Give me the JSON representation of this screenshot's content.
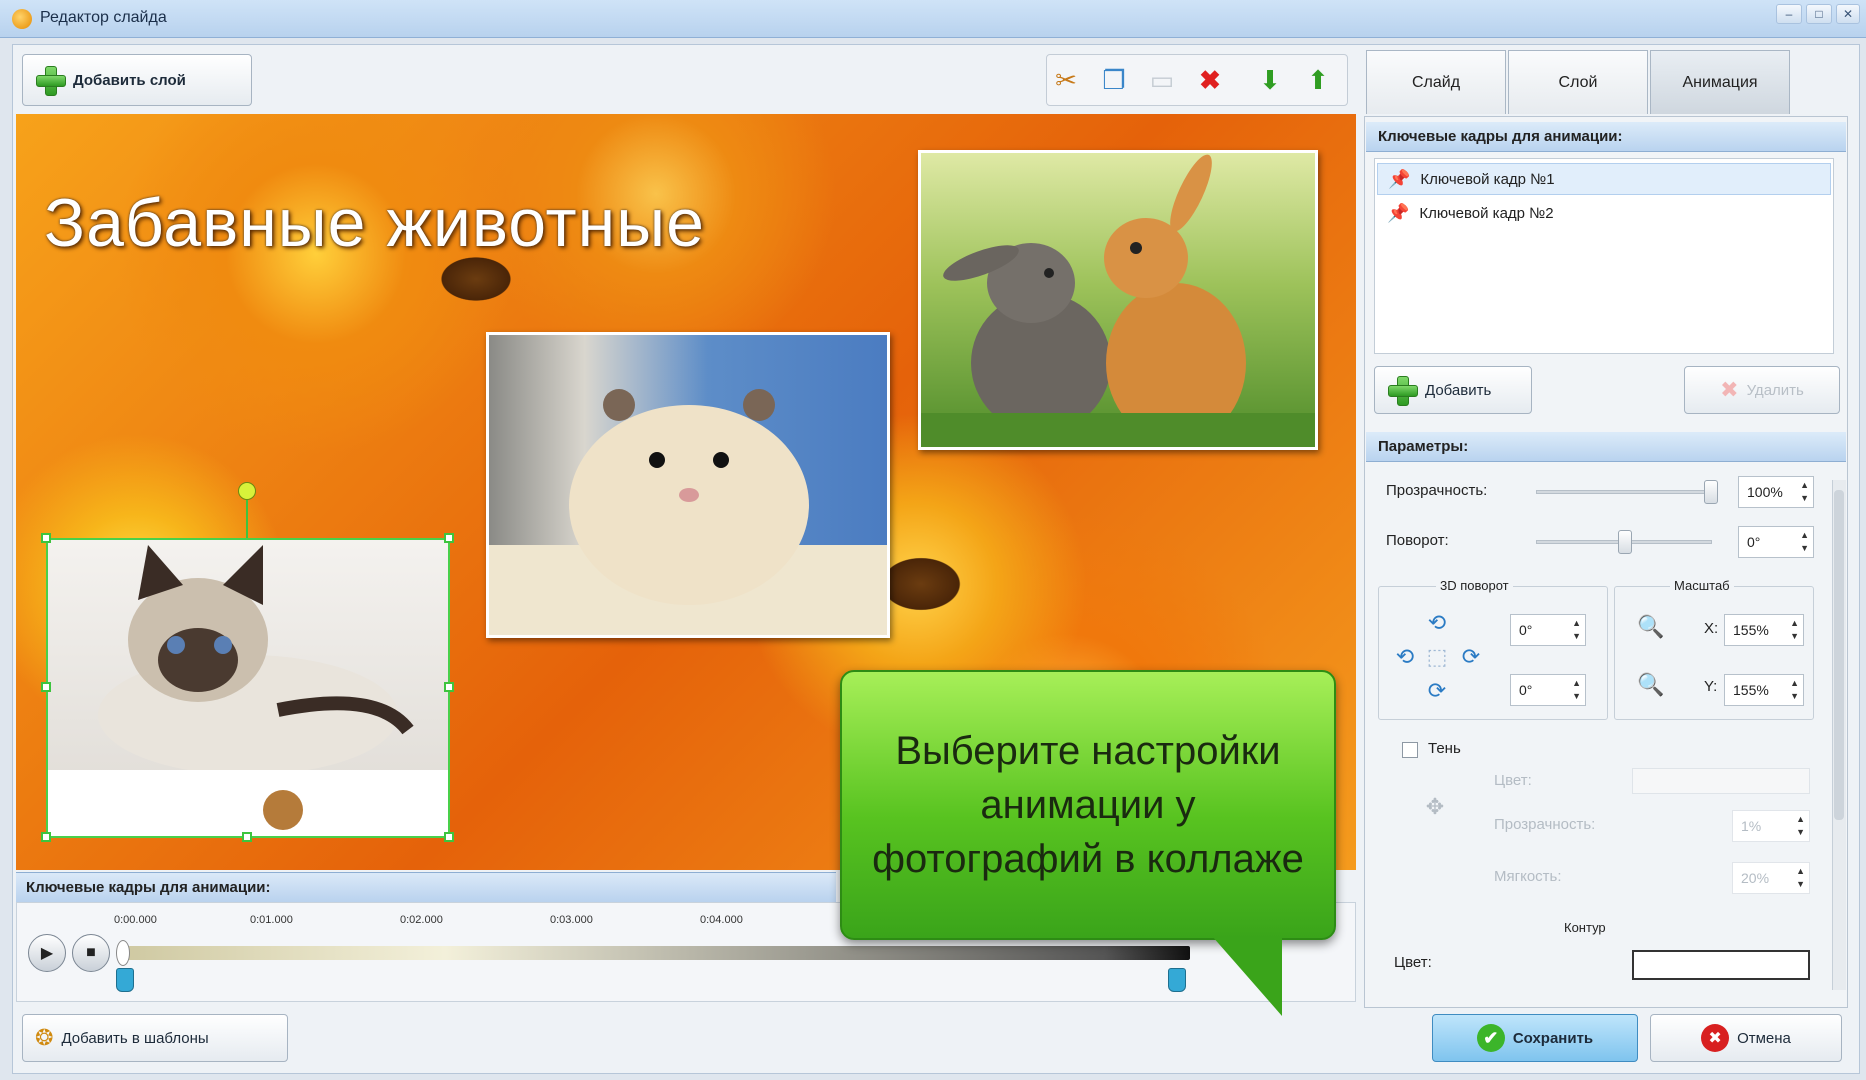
{
  "window": {
    "title": "Редактор слайда"
  },
  "toolbar": {
    "add_layer_label": "Добавить слой"
  },
  "slide": {
    "title": "Забавные животные"
  },
  "callout": {
    "text": "Выберите настройки анимации у фотографий в коллаже"
  },
  "timeline": {
    "header": "Ключевые кадры для анимации:",
    "ticks": [
      "0:00.000",
      "0:01.000",
      "0:02.000",
      "0:03.000",
      "0:04.000"
    ]
  },
  "bottom": {
    "add_template_label": "Добавить в шаблоны",
    "save_label": "Сохранить",
    "cancel_label": "Отмена"
  },
  "tabs": [
    {
      "label": "Слайд"
    },
    {
      "label": "Слой"
    },
    {
      "label": "Анимация"
    }
  ],
  "keyframes": {
    "header": "Ключевые кадры для анимации:",
    "items": [
      {
        "label": "Ключевой кадр №1"
      },
      {
        "label": "Ключевой кадр №2"
      }
    ],
    "add_label": "Добавить",
    "delete_label": "Удалить"
  },
  "params": {
    "header": "Параметры:",
    "opacity_label": "Прозрачность:",
    "opacity_value": "100%",
    "rotation_label": "Поворот:",
    "rotation_value": "0°",
    "rotate3d_label": "3D поворот",
    "rotate3d_x": "0°",
    "rotate3d_y": "0°",
    "scale_label": "Масштаб",
    "scale_x_label": "X:",
    "scale_x": "155%",
    "scale_y_label": "Y:",
    "scale_y": "155%",
    "shadow_label": "Тень",
    "shadow_color_label": "Цвет:",
    "shadow_opacity_label": "Прозрачность:",
    "shadow_opacity_value": "1%",
    "shadow_blur_label": "Мягкость:",
    "shadow_blur_value": "20%",
    "contour_label": "Контур",
    "contour_color_label": "Цвет:"
  }
}
